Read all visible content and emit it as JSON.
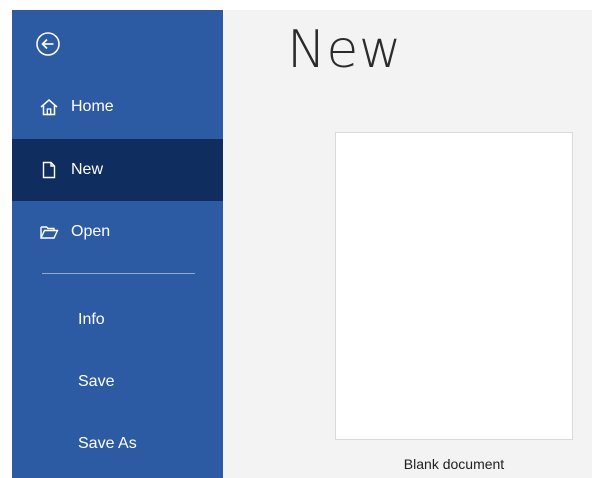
{
  "sidebar": {
    "back_icon": "back-arrow-circle-icon",
    "items": [
      {
        "label": "Home",
        "icon": "home-icon"
      },
      {
        "label": "New",
        "icon": "new-document-icon",
        "active": true
      },
      {
        "label": "Open",
        "icon": "open-folder-icon"
      },
      {
        "label": "Info"
      },
      {
        "label": "Save"
      },
      {
        "label": "Save As"
      }
    ]
  },
  "main": {
    "title": "New",
    "templates": [
      {
        "label": "Blank document"
      }
    ]
  },
  "colors": {
    "sidebar_bg": "#2c5aa3",
    "active_item_bg": "#0f2d5e",
    "main_bg": "#f3f3f3"
  }
}
